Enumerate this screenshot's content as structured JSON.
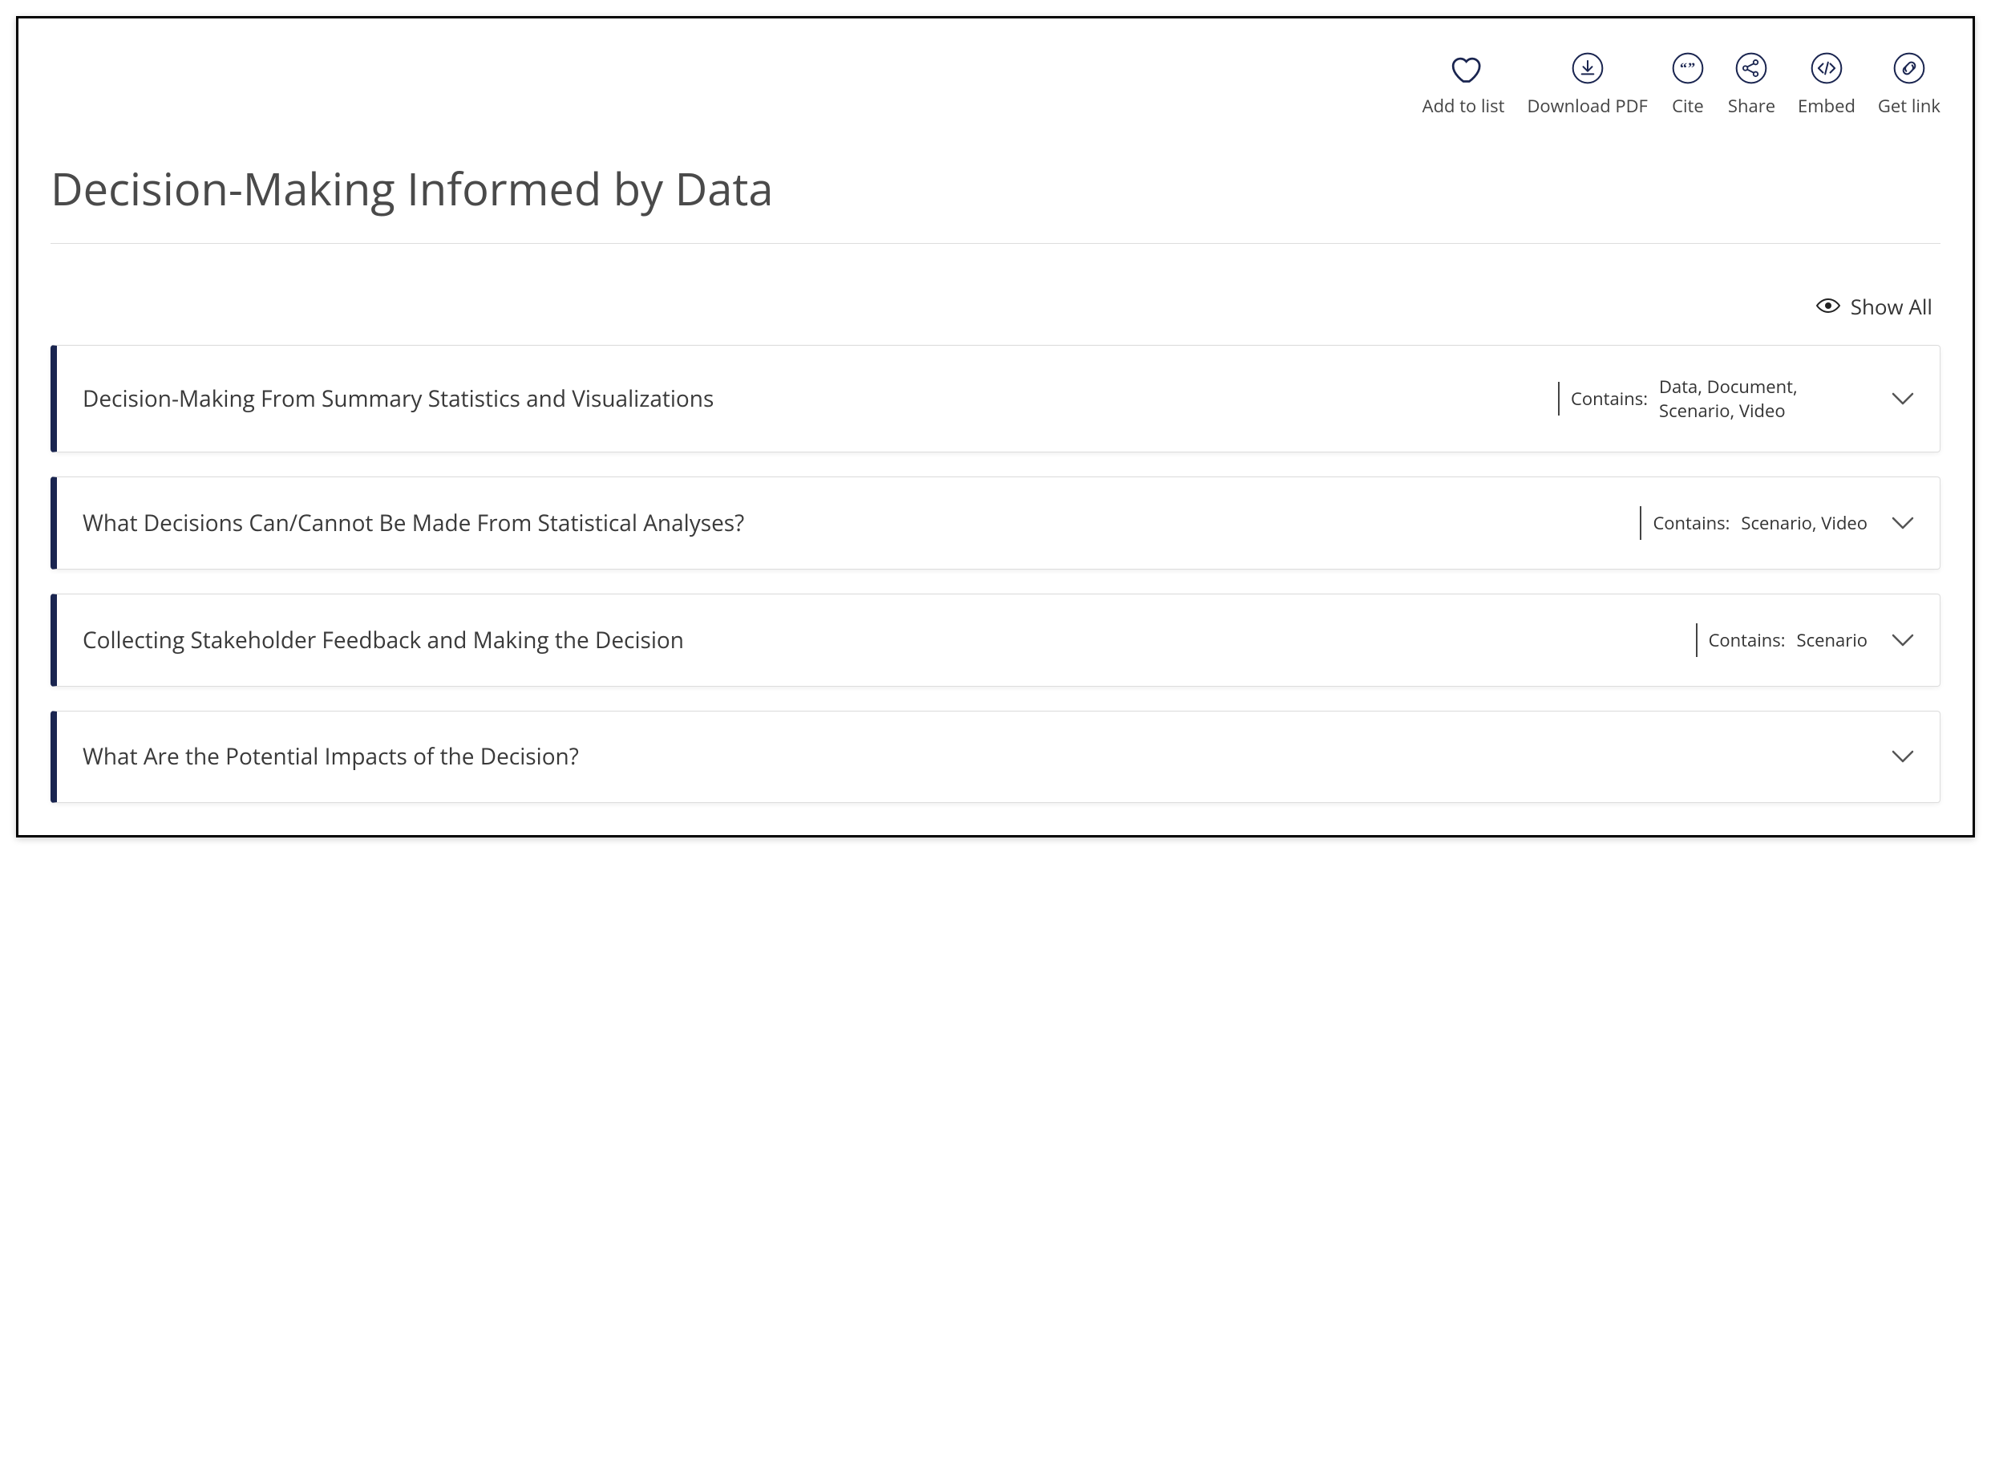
{
  "toolbar": {
    "items": [
      {
        "id": "add-to-list",
        "label": "Add to list",
        "icon": "heart"
      },
      {
        "id": "download-pdf",
        "label": "Download PDF",
        "icon": "download"
      },
      {
        "id": "cite",
        "label": "Cite",
        "icon": "quote"
      },
      {
        "id": "share",
        "label": "Share",
        "icon": "share"
      },
      {
        "id": "embed",
        "label": "Embed",
        "icon": "code"
      },
      {
        "id": "get-link",
        "label": "Get link",
        "icon": "link"
      }
    ]
  },
  "page": {
    "title": "Decision-Making Informed by Data"
  },
  "show_all": {
    "label": "Show All"
  },
  "contains_label": "Contains:",
  "sections": [
    {
      "title": "Decision-Making From Summary Statistics and Visualizations",
      "contains": "Data, Document, Scenario, Video"
    },
    {
      "title": "What Decisions Can/Cannot Be Made From Statistical Analyses?",
      "contains": "Scenario, Video"
    },
    {
      "title": "Collecting Stakeholder Feedback and Making the Decision",
      "contains": "Scenario"
    },
    {
      "title": "What Are the Potential Impacts of the Decision?",
      "contains": ""
    }
  ]
}
